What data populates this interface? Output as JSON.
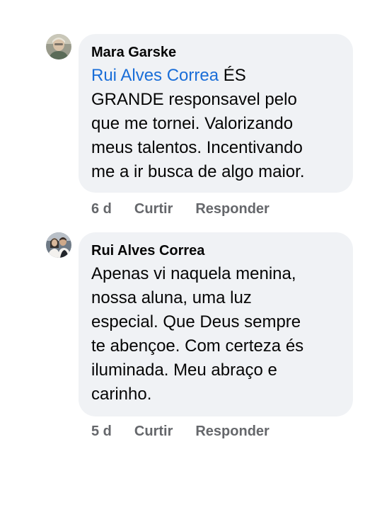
{
  "comments": [
    {
      "author": "Mara Garske",
      "mention": "Rui Alves Correa",
      "text_line1_rest": " ÉS",
      "text_lines": [
        "GRANDE responsavel pelo",
        "que me tornei. Valorizando",
        "meus talentos. Incentivando",
        "me a ir busca de algo maior."
      ],
      "time": "6 d",
      "like_label": "Curtir",
      "reply_label": "Responder",
      "avatar_icon": "user-avatar-photo"
    },
    {
      "author": "Rui Alves Correa",
      "text_lines": [
        "Apenas vi naquela menina,",
        "nossa aluna, uma luz",
        "especial. Que Deus sempre",
        "te abençoe. Com certeza és",
        "iluminada. Meu abraço e",
        "carinho."
      ],
      "time": "5 d",
      "like_label": "Curtir",
      "reply_label": "Responder",
      "avatar_icon": "user-avatar-photo"
    }
  ],
  "colors": {
    "bubble_bg": "#f0f2f5",
    "mention": "#1a6ed8",
    "action_text": "#65676b"
  }
}
